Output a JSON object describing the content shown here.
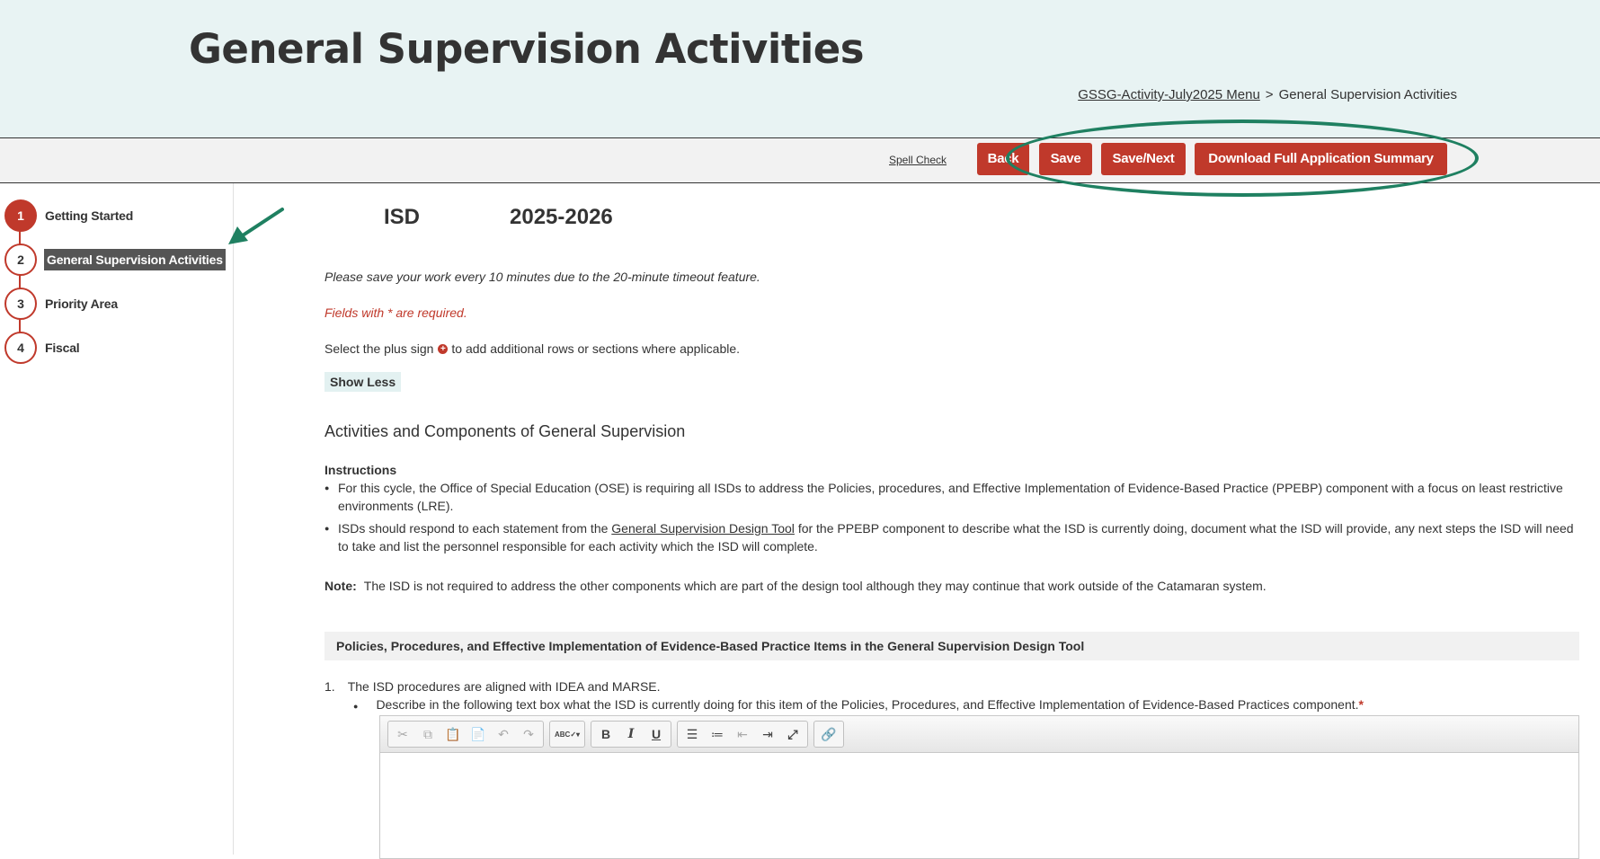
{
  "header": {
    "title": "General Supervision Activities",
    "breadcrumb": {
      "link": "GSSG-Activity-July2025 Menu",
      "separator": ">",
      "current": "General Supervision Activities"
    }
  },
  "toolbar": {
    "spell_check": "Spell Check",
    "back": "Back",
    "save": "Save",
    "save_next": "Save/Next",
    "download": "Download Full Application Summary"
  },
  "sidebar": {
    "steps": [
      {
        "num": "1",
        "label": "Getting Started"
      },
      {
        "num": "2",
        "label": "General Supervision Activities"
      },
      {
        "num": "3",
        "label": "Priority Area"
      },
      {
        "num": "4",
        "label": "Fiscal"
      }
    ]
  },
  "main": {
    "org": "ISD",
    "year": "2025-2026",
    "save_note": "Please save your work every 10 minutes due to the 20-minute timeout feature.",
    "required_note": "Fields with * are required.",
    "plus_note_before": "Select the plus sign",
    "plus_note_after": "to add additional rows or sections where applicable.",
    "show_less": "Show Less",
    "section_title": "Activities and Components of General Supervision",
    "instructions_heading": "Instructions",
    "bullet1": "For this cycle, the Office of Special Education (OSE) is requiring all ISDs to address the Policies, procedures, and Effective Implementation of Evidence-Based Practice (PPEBP) component with a focus on least restrictive environments (LRE).",
    "bullet2_before": "ISDs should respond to each statement from the",
    "bullet2_link": "General Supervision Design Tool",
    "bullet2_after": "for the PPEBP component to describe what the ISD is currently doing, document what the ISD will provide, any next steps the ISD will need to take and list the personnel responsible for each activity which the ISD will complete.",
    "note_label": "Note:",
    "note_text": "The ISD is not required to address the other components which are part of the design tool although they may continue that work outside of the Catamaran system.",
    "ppebp_header": "Policies, Procedures, and Effective Implementation of Evidence-Based Practice Items in the General Supervision Design Tool",
    "item1_num": "1.",
    "item1_text": "The ISD procedures are aligned with IDEA and MARSE.",
    "item1_desc": "Describe in the following text box what the ISD is currently doing for this item of the Policies, Procedures, and Effective Implementation of Evidence-Based Practices component.",
    "required_mark": "*"
  },
  "editor_toolbar": {
    "spellcheck_glyph": "ABC",
    "bold": "B",
    "italic": "I",
    "underline": "U"
  },
  "colors": {
    "accent_red": "#c0392b",
    "header_bg": "#e8f3f3",
    "annotation_green": "#1f8061"
  }
}
